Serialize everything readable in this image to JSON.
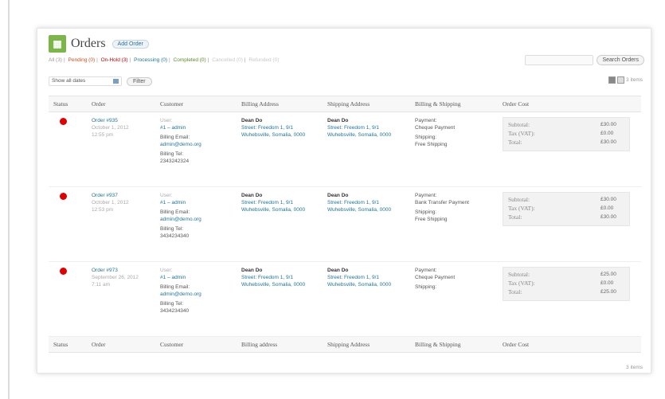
{
  "header": {
    "title": "Orders",
    "add_label": "Add Order"
  },
  "filters": {
    "all": "All (3)",
    "pending": "Pending (0)",
    "onhold": "On-Hold (3)",
    "processing": "Processing (0)",
    "completed": "Completed (0)",
    "cancelled": "Cancelled (0)",
    "refunded": "Refunded (0)"
  },
  "search": {
    "button": "Search Orders",
    "placeholder": ""
  },
  "toolbar": {
    "select_value": "Show all dates",
    "filter_label": "Filter",
    "items_count": "3 items"
  },
  "columns": [
    "Status",
    "Order",
    "Customer",
    "Billing Address",
    "Shipping Address",
    "Billing & Shipping",
    "Order Cost"
  ],
  "footer_columns": [
    "Status",
    "Order",
    "Customer",
    "Billing address",
    "Shipping Address",
    "Billing & Shipping",
    "Order Cost"
  ],
  "orders": [
    {
      "order": "Order #935",
      "date": "October 1, 2012",
      "time": "12:55 pm",
      "customer_label": "User:",
      "customer": "#1 – admin",
      "email_label": "Billing Email:",
      "email": "admin@demo.org",
      "tel_label": "Billing Tel:",
      "tel": "2343242324",
      "billing_name": "Dean Do",
      "billing_line1": "Street: Freedom 1, 9/1",
      "billing_line2": "Wuhebsville, Somalia, 0000",
      "shipping_name": "Dean Do",
      "shipping_line1": "Street: Freedom 1, 9/1",
      "shipping_line2": "Wuhebsville, Somalia, 0000",
      "payment_label": "Payment:",
      "payment": "Cheque Payment",
      "shipping_label": "Shipping:",
      "shipping": "Free Shipping",
      "subtotal_label": "Subtotal:",
      "subtotal": "£30.00",
      "tax_label": "Tax (VAT):",
      "tax": "£0.00",
      "total_label": "Total:",
      "total": "£30.00"
    },
    {
      "order": "Order #937",
      "date": "October 1, 2012",
      "time": "12:53 pm",
      "customer_label": "User:",
      "customer": "#1 – admin",
      "email_label": "Billing Email:",
      "email": "admin@demo.org",
      "tel_label": "Billing Tel:",
      "tel": "3434234340",
      "billing_name": "Dean Do",
      "billing_line1": "Street: Freedom 1, 9/1",
      "billing_line2": "Wuhebsville, Somalia, 0000",
      "shipping_name": "Dean Do",
      "shipping_line1": "Street: Freedom 1, 9/1",
      "shipping_line2": "Wuhebsville, Somalia, 0000",
      "payment_label": "Payment:",
      "payment": "Bank Transfer Payment",
      "shipping_label": "Shipping:",
      "shipping": "Free Shipping",
      "subtotal_label": "Subtotal:",
      "subtotal": "£30.00",
      "tax_label": "Tax (VAT):",
      "tax": "£0.00",
      "total_label": "Total:",
      "total": "£30.00"
    },
    {
      "order": "Order #973",
      "date": "September 26, 2012",
      "time": "7:11 am",
      "customer_label": "User:",
      "customer": "#1 – admin",
      "email_label": "Billing Email:",
      "email": "admin@demo.org",
      "tel_label": "Billing Tel:",
      "tel": "3434234340",
      "billing_name": "Dean Do",
      "billing_line1": "Street: Freedom 1, 9/1",
      "billing_line2": "Wuhebsville, Somalia, 0000",
      "shipping_name": "Dean Do",
      "shipping_line1": "Street: Freedom 1, 9/1",
      "shipping_line2": "Wuhebsville, Somalia, 0000",
      "payment_label": "Payment:",
      "payment": "Cheque Payment",
      "shipping_label": "Shipping:",
      "shipping": "",
      "subtotal_label": "Subtotal:",
      "subtotal": "£25.00",
      "tax_label": "Tax (VAT):",
      "tax": "£0.00",
      "total_label": "Total:",
      "total": "£25.00"
    }
  ],
  "footer": {
    "items_count": "3 items"
  },
  "colors": {
    "status_dot": "#e00000",
    "link": "#21759b",
    "logo": "#7ab648"
  }
}
